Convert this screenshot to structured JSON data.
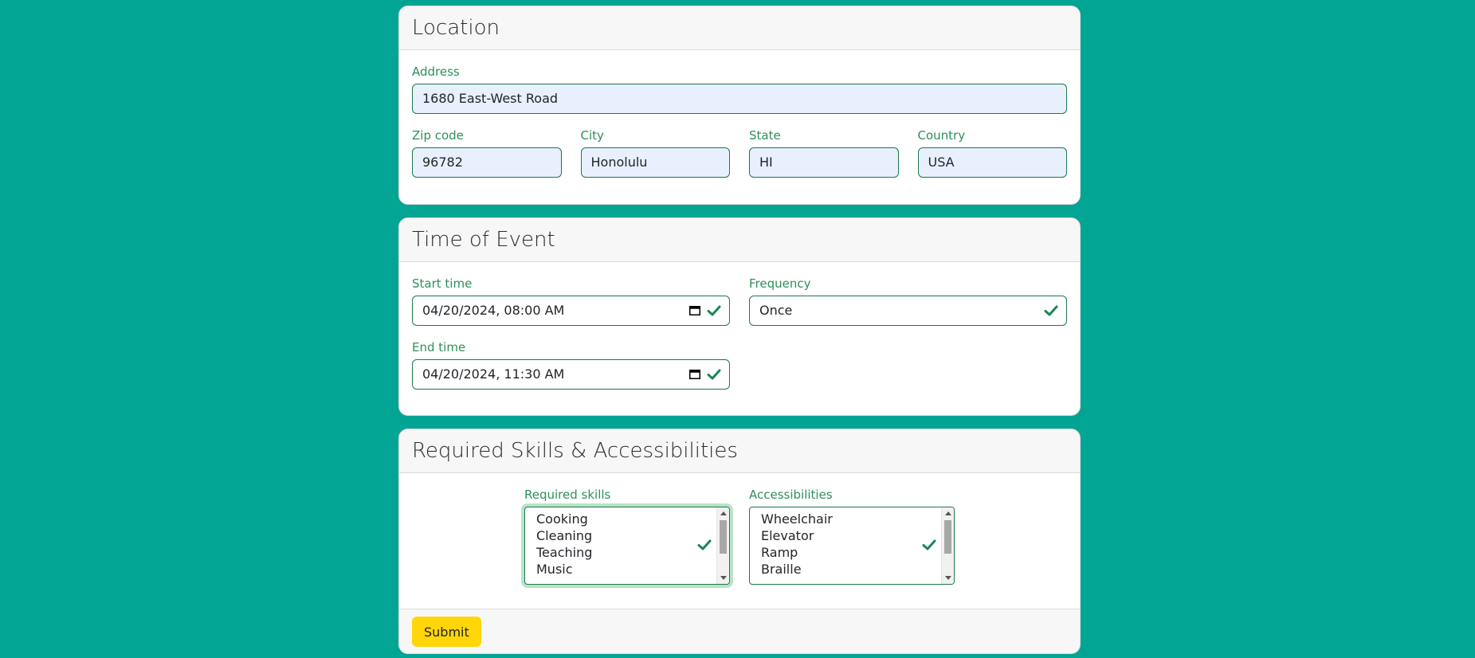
{
  "location": {
    "title": "Location",
    "address_label": "Address",
    "address_value": "1680 East-West Road",
    "zip_label": "Zip code",
    "zip_value": "96782",
    "city_label": "City",
    "city_value": "Honolulu",
    "state_label": "State",
    "state_value": "HI",
    "country_label": "Country",
    "country_value": "USA"
  },
  "time": {
    "title": "Time of Event",
    "start_label": "Start time",
    "start_value": "04/20/2024, 08:00 AM",
    "frequency_label": "Frequency",
    "frequency_value": "Once",
    "end_label": "End time",
    "end_value": "04/20/2024, 11:30 AM"
  },
  "skills": {
    "title": "Required Skills & Accessibilities",
    "skills_label": "Required skills",
    "skills_options": [
      "Cooking",
      "Cleaning",
      "Teaching",
      "Music"
    ],
    "access_label": "Accessibilities",
    "access_options": [
      "Wheelchair",
      "Elevator",
      "Ramp",
      "Braille"
    ]
  },
  "footer": {
    "submit_label": "Submit"
  },
  "colors": {
    "background": "#02a494",
    "label": "#2f8f57",
    "border": "#1b7a4a",
    "autofill": "#e8f0fe",
    "submit": "#ffd60a"
  }
}
